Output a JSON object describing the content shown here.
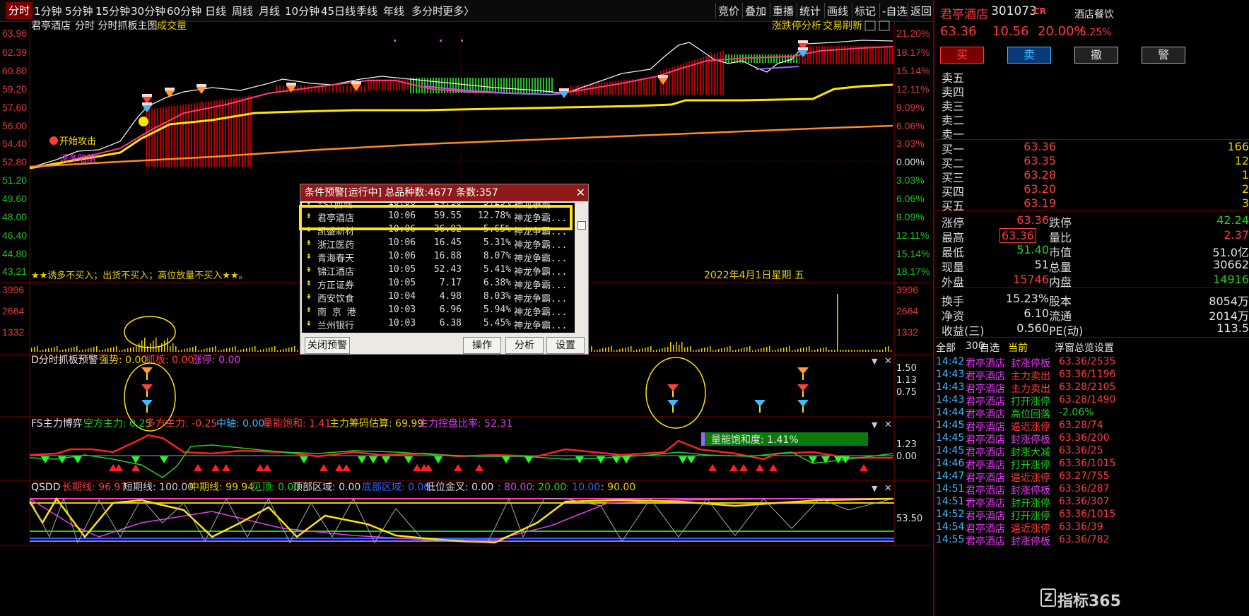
{
  "toolbar": {
    "periods": [
      "分时",
      "1分钟",
      "5分钟",
      "15分钟",
      "30分钟",
      "60分钟",
      "日线",
      "周线",
      "月线",
      "10分钟",
      "45日线",
      "季线",
      "年线",
      "多分时",
      "更多〉"
    ],
    "active_index": 0,
    "right_items": [
      "竞价",
      "叠加",
      "重播",
      "统计",
      "画线",
      "标记",
      "-自选",
      "返回"
    ]
  },
  "main_chart": {
    "title_stock": "君亭酒店",
    "title_rest": "分时 分时抓板主图",
    "title_vol": "成交量",
    "links": [
      "涨跌停分析",
      "交易刷新"
    ],
    "left_ticks": [
      "63.96",
      "62.39",
      "60.80",
      "59.20",
      "57.60",
      "56.00",
      "54.40",
      "52.80",
      "51.20",
      "49.60",
      "48.00",
      "46.40",
      "44.80",
      "43.21"
    ],
    "right_ticks": [
      "21.20%",
      "18.17%",
      "15.14%",
      "12.11%",
      "9.09%",
      "6.06%",
      "3.03%",
      "0.00%",
      "3.03%",
      "6.06%",
      "9.09%",
      "12.11%",
      "15.14%",
      "18.17%"
    ],
    "attack_label": "开始攻击",
    "lure_label": "诱多陷阱",
    "warning_text": "★★诱多不买入；出货不买入；高位放量不买入★★。",
    "date_text": "2022年4月1日星期 五",
    "volume_ticks": [
      "3996",
      "2664",
      "1332"
    ]
  },
  "panel_d": {
    "name": "D分时抓板预警",
    "items": [
      {
        "label": "强势:",
        "value": "0.00",
        "color": "#e8d000"
      },
      {
        "label": "抓板:",
        "value": "0.00",
        "color": "#ff3b3b"
      },
      {
        "label": "涨停:",
        "value": "0.00",
        "color": "#e23cf0"
      }
    ],
    "ticks": [
      "1.50",
      "1.13",
      "0.75"
    ]
  },
  "panel_fs": {
    "name": "FS主力博弈",
    "items": [
      {
        "label": "空方主力:",
        "value": "0.25",
        "color": "#20d020"
      },
      {
        "label": "多方主力:",
        "value": "-0.25",
        "color": "#ff3b3b"
      },
      {
        "label": "中轴:",
        "value": "0.00",
        "color": "#3fb9ff"
      },
      {
        "label": "量能饱和:",
        "value": "1.41",
        "color": "#ff3b3b"
      },
      {
        "label": "主力筹码估算:",
        "value": "69.99",
        "color": "#e8d000"
      },
      {
        "label": "主力控盘比率:",
        "value": "52.31",
        "color": "#e23cf0"
      }
    ],
    "saturation_label": "量能饱和度:",
    "saturation_value": "1.41%",
    "ticks": [
      "1.23",
      "0.00"
    ]
  },
  "panel_qsdd": {
    "name": "QSDD",
    "items": [
      {
        "label": "长期线:",
        "value": "96.97",
        "color": "#ff3b3b"
      },
      {
        "label": "短期线:",
        "value": "100.00",
        "color": "#cfcfcf"
      },
      {
        "label": "中期线:",
        "value": "99.94",
        "color": "#e8d000"
      },
      {
        "label": "见顶:",
        "value": "0.00",
        "color": "#20d020"
      },
      {
        "label": "顶部区域:",
        "value": "0.00",
        "color": "#dcdcdc"
      },
      {
        "label": "底部区域:",
        "value": "0.00",
        "color": "#3060ff"
      },
      {
        "label": "低位金叉:",
        "value": "0.00",
        "color": "#dcdcdc"
      },
      {
        "label": ":",
        "value": "80.00",
        "color": "#e23cf0"
      },
      {
        "label": ":",
        "value": "20.00",
        "color": "#20d020"
      },
      {
        "label": ":",
        "value": "10.00",
        "color": "#3060ff"
      },
      {
        "label": ":",
        "value": "90.00",
        "color": "#e8d000"
      }
    ],
    "tick": "53.50"
  },
  "dialog": {
    "title": "条件预警[运行中] 总品种数:4677 条数:357",
    "rows": [
      {
        "name": "*ST西域",
        "time": "10:06",
        "price": "24.90",
        "pct": "5.29%",
        "note": "神龙争霸..."
      },
      {
        "name": "君亭酒店",
        "time": "10:06",
        "price": "59.55",
        "pct": "12.78%",
        "note": "神龙争霸..."
      },
      {
        "name": "凯盛新材",
        "time": "10:06",
        "price": "36.82",
        "pct": "5.65%",
        "note": "神龙争霸..."
      },
      {
        "name": "浙江医药",
        "time": "10:06",
        "price": "16.45",
        "pct": "5.31%",
        "note": "神龙争霸..."
      },
      {
        "name": "青海春天",
        "time": "10:06",
        "price": "16.88",
        "pct": "8.07%",
        "note": "神龙争霸..."
      },
      {
        "name": "锦江酒店",
        "time": "10:05",
        "price": "52.43",
        "pct": "5.41%",
        "note": "神龙争霸..."
      },
      {
        "name": "方正证券",
        "time": "10:05",
        "price": "7.17",
        "pct": "6.38%",
        "note": "神龙争霸..."
      },
      {
        "name": "西安饮食",
        "time": "10:04",
        "price": "4.98",
        "pct": "8.03%",
        "note": "神龙争霸..."
      },
      {
        "name": "南 京 港",
        "time": "10:03",
        "price": "6.96",
        "pct": "5.94%",
        "note": "神龙争霸..."
      },
      {
        "name": "兰州银行",
        "time": "10:03",
        "price": "6.38",
        "pct": "5.45%",
        "note": "神龙争霸..."
      }
    ],
    "close_btn": "关闭预警",
    "btns": [
      "操作",
      "分析",
      "设置"
    ]
  },
  "quote": {
    "stock_name": "君亭酒店",
    "code": "301073",
    "tag": "CR",
    "sector": "酒店餐饮",
    "sector_pct": "5.25%",
    "price": "63.36",
    "change": "10.56",
    "pct": "20.00%",
    "actions": [
      "买",
      "卖",
      "撤",
      "警"
    ],
    "sells": [
      {
        "label": "卖五",
        "price": "",
        "vol": ""
      },
      {
        "label": "卖四",
        "price": "",
        "vol": ""
      },
      {
        "label": "卖三",
        "price": "",
        "vol": ""
      },
      {
        "label": "卖二",
        "price": "",
        "vol": ""
      },
      {
        "label": "卖一",
        "price": "",
        "vol": ""
      }
    ],
    "buys": [
      {
        "label": "买一",
        "price": "63.36",
        "vol": "166"
      },
      {
        "label": "买二",
        "price": "63.35",
        "vol": "12"
      },
      {
        "label": "买三",
        "price": "63.28",
        "vol": "1"
      },
      {
        "label": "买四",
        "price": "63.20",
        "vol": "2"
      },
      {
        "label": "买五",
        "price": "63.19",
        "vol": "3"
      }
    ],
    "stats": [
      {
        "l1": "涨停",
        "v1": "63.36",
        "c1": "red",
        "l2": "跌停",
        "v2": "42.24",
        "c2": "grn"
      },
      {
        "l1": "最高",
        "v1": "63.36",
        "c1": "red",
        "l2": "量比",
        "v2": "2.37",
        "c2": "red"
      },
      {
        "l1": "最低",
        "v1": "51.40",
        "c1": "grn",
        "l2": "市值",
        "v2": "51.0亿",
        "c2": "wht"
      },
      {
        "l1": "现量",
        "v1": "51",
        "c1": "wht",
        "l2": "总量",
        "v2": "30662",
        "c2": "wht"
      },
      {
        "l1": "外盘",
        "v1": "15746",
        "c1": "red",
        "l2": "内盘",
        "v2": "14916",
        "c2": "grn"
      },
      {
        "l1": "换手",
        "v1": "15.23%",
        "c1": "wht",
        "l2": "股本",
        "v2": "8054万",
        "c2": "wht"
      },
      {
        "l1": "净资",
        "v1": "6.10",
        "c1": "wht",
        "l2": "流通",
        "v2": "2014万",
        "c2": "wht"
      },
      {
        "l1": "收益(三)",
        "v1": "0.560",
        "c1": "wht",
        "l2": "PE(动)",
        "v2": "113.5",
        "c2": "wht"
      }
    ],
    "tabs": [
      "全部",
      "300",
      "自选",
      "当前"
    ],
    "tabs_right": [
      "浮窗",
      "总览",
      "设置"
    ],
    "trades": [
      {
        "t": "14:42",
        "n": "君亭酒店",
        "e": "封涨停板",
        "v": "63.36/2535"
      },
      {
        "t": "14:43",
        "n": "君亭酒店",
        "e": "主力卖出",
        "v": "63.36/1196"
      },
      {
        "t": "14:43",
        "n": "君亭酒店",
        "e": "主力卖出",
        "v": "63.28/2105"
      },
      {
        "t": "14:43",
        "n": "君亭酒店",
        "e": "打开涨停",
        "v": "63.28/1490"
      },
      {
        "t": "14:44",
        "n": "君亭酒店",
        "e": "高位回落",
        "v": "-2.06%"
      },
      {
        "t": "14:45",
        "n": "君亭酒店",
        "e": "逼近涨停",
        "v": "63.28/74"
      },
      {
        "t": "14:45",
        "n": "君亭酒店",
        "e": "封涨停板",
        "v": "63.36/200"
      },
      {
        "t": "14:45",
        "n": "君亭酒店",
        "e": "封涨大减",
        "v": "63.36/25"
      },
      {
        "t": "14:46",
        "n": "君亭酒店",
        "e": "打开涨停",
        "v": "63.36/1015"
      },
      {
        "t": "14:47",
        "n": "君亭酒店",
        "e": "逼近涨停",
        "v": "63.27/755"
      },
      {
        "t": "14:51",
        "n": "君亭酒店",
        "e": "封涨停板",
        "v": "63.36/287"
      },
      {
        "t": "14:51",
        "n": "君亭酒店",
        "e": "封开涨停",
        "v": "63.36/307"
      },
      {
        "t": "14:52",
        "n": "君亭酒店",
        "e": "打开涨停",
        "v": "63.36/1015"
      },
      {
        "t": "14:54",
        "n": "君亭酒店",
        "e": "逼近涨停",
        "v": "63.36/39"
      },
      {
        "t": "14:55",
        "n": "君亭酒店",
        "e": "封涨停板",
        "v": "63.36/782"
      }
    ],
    "trade_colors": [
      "#e23cf0",
      "#ff3b3b",
      "#ff3b3b",
      "#20d020",
      "#20d020",
      "#ff3b3b",
      "#e23cf0",
      "#20d020",
      "#20d020",
      "#ff3b3b",
      "#e23cf0",
      "#20d020",
      "#20d020",
      "#ff3b3b",
      "#e23cf0"
    ],
    "watermark": "指标365"
  },
  "colors": {
    "accent": "#7a0000",
    "up": "#ff3b3b",
    "down": "#20d020",
    "yellow": "#e8d000",
    "highlight": "#ffe600"
  }
}
